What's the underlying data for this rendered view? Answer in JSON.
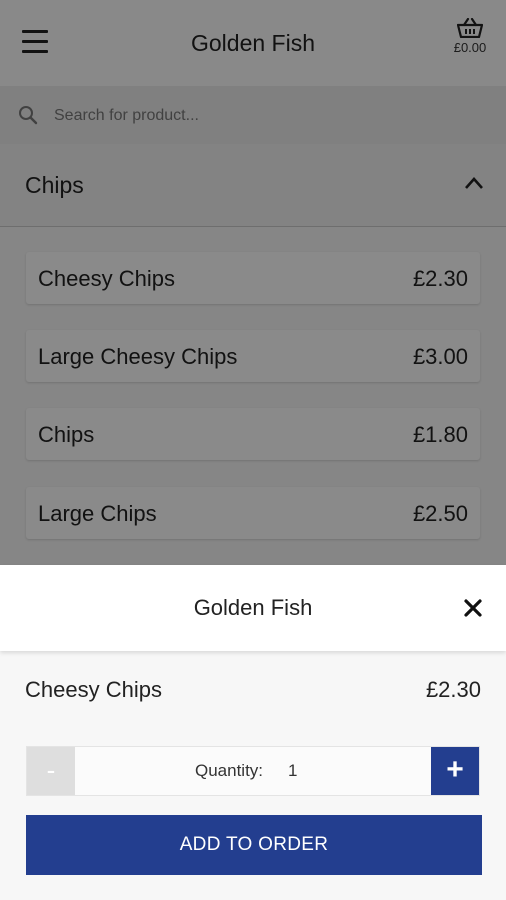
{
  "header": {
    "title": "Golden Fish",
    "basket_total": "£0.00"
  },
  "search": {
    "placeholder": "Search for product..."
  },
  "category": {
    "label": "Chips"
  },
  "products": [
    {
      "name": "Cheesy Chips",
      "price": "£2.30"
    },
    {
      "name": "Large Cheesy Chips",
      "price": "£3.00"
    },
    {
      "name": "Chips",
      "price": "£1.80"
    },
    {
      "name": "Large Chips",
      "price": "£2.50"
    }
  ],
  "sheet": {
    "title": "Golden Fish",
    "item_name": "Cheesy Chips",
    "item_price": "£2.30",
    "quantity_label": "Quantity:",
    "quantity_value": "1",
    "minus_label": "-",
    "plus_label": "+",
    "add_button_label": "ADD TO ORDER"
  },
  "colors": {
    "primary": "#233e8f",
    "overlay": "#000000"
  }
}
